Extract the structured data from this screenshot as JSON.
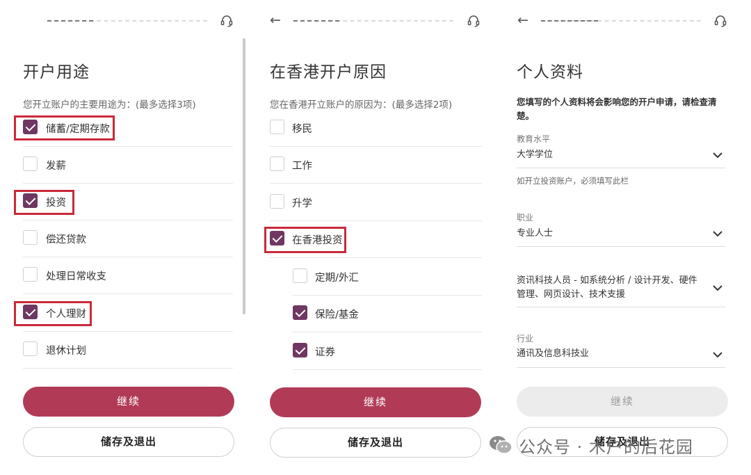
{
  "colors": {
    "accent": "#6f3762",
    "primary_button": "#b13b57",
    "highlight": "#c9293a"
  },
  "panel1": {
    "title": "开户用途",
    "subtitle": "您开立账户的主要用途为：(最多选择3项)",
    "options": [
      {
        "label": "储蓄/定期存款",
        "checked": true
      },
      {
        "label": "发薪",
        "checked": false
      },
      {
        "label": "投资",
        "checked": true
      },
      {
        "label": "偿还贷款",
        "checked": false
      },
      {
        "label": "处理日常收支",
        "checked": false
      },
      {
        "label": "个人理财",
        "checked": true
      },
      {
        "label": "退休计划",
        "checked": false
      }
    ],
    "continue_label": "继续",
    "save_exit_label": "储存及退出"
  },
  "panel2": {
    "title": "在香港开户原因",
    "subtitle": "您在香港开立账户的原因为：(最多选择2项)",
    "options": [
      {
        "label": "移民",
        "checked": false
      },
      {
        "label": "工作",
        "checked": false
      },
      {
        "label": "升学",
        "checked": false
      },
      {
        "label": "在香港投资",
        "checked": true
      }
    ],
    "sub_options": [
      {
        "label": "定期/外汇",
        "checked": false
      },
      {
        "label": "保险/基金",
        "checked": true
      },
      {
        "label": "证券",
        "checked": true
      }
    ],
    "continue_label": "继续",
    "save_exit_label": "储存及退出"
  },
  "panel3": {
    "title": "个人资料",
    "notice": "您填写的个人资料将会影响您的开户申请，请检查清楚。",
    "fields": {
      "education": {
        "label": "教育水平",
        "value": "大学学位",
        "hint": "如开立投资账户，必须填写此栏"
      },
      "occupation": {
        "label": "职业",
        "value": "专业人士"
      },
      "position": {
        "value": "资讯科技人员 - 如系统分析 / 设计开发、硬件管理、网页设计、技术支援"
      },
      "industry": {
        "label": "行业",
        "value": "通讯及信息科技业"
      }
    },
    "continue_label": "继续",
    "save_exit_label": "储存及退出"
  },
  "watermark": {
    "text": "公众号 · 木户的后花园",
    "icon": "wechat-icon"
  },
  "icons": {
    "back": "back-arrow-icon",
    "support": "headset-icon",
    "dropdown": "chevron-down-icon",
    "checked": "check-icon"
  }
}
